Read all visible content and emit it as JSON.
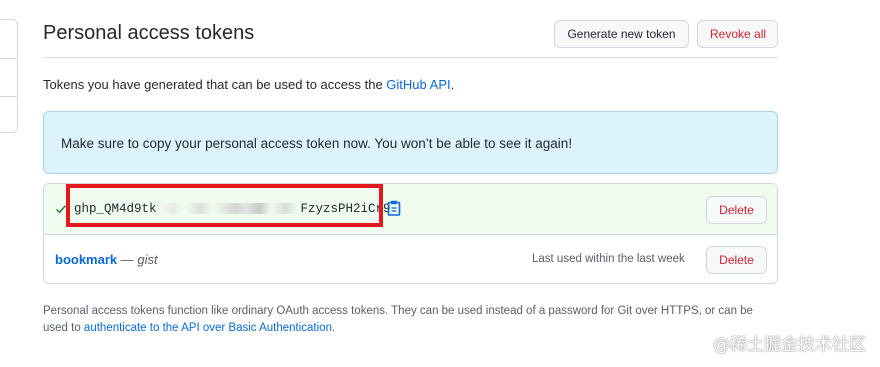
{
  "header": {
    "title": "Personal access tokens",
    "generate_label": "Generate new token",
    "revoke_label": "Revoke all"
  },
  "intro": {
    "text_before": "Tokens you have generated that can be used to access the ",
    "link_text": "GitHub API",
    "text_after": "."
  },
  "flash": {
    "message": "Make sure to copy your personal access token now. You won’t be able to see it again!"
  },
  "tokens": {
    "new_token": {
      "prefix": "ghp_QM4d9tk",
      "suffix": "FzyzsPH2iCr9",
      "delete_label": "Delete"
    },
    "existing": {
      "name": "bookmark",
      "dash": " — ",
      "scope": "gist",
      "last_used": "Last used within the last week",
      "delete_label": "Delete"
    }
  },
  "footnote": {
    "text": "Personal access tokens function like ordinary OAuth access tokens. They can be used instead of a password for Git over HTTPS, or can be used to ",
    "link_text": "authenticate to the API over Basic Authentication",
    "text_after": "."
  },
  "watermark": "@稀土掘金技术社区",
  "colors": {
    "accent_link": "#0969da",
    "danger": "#cf222e",
    "flash_bg": "#ddf4ff",
    "new_token_bg": "#f0fbf0",
    "highlight": "#e5171f"
  },
  "icons": [
    "check-icon",
    "clipboard-icon"
  ]
}
